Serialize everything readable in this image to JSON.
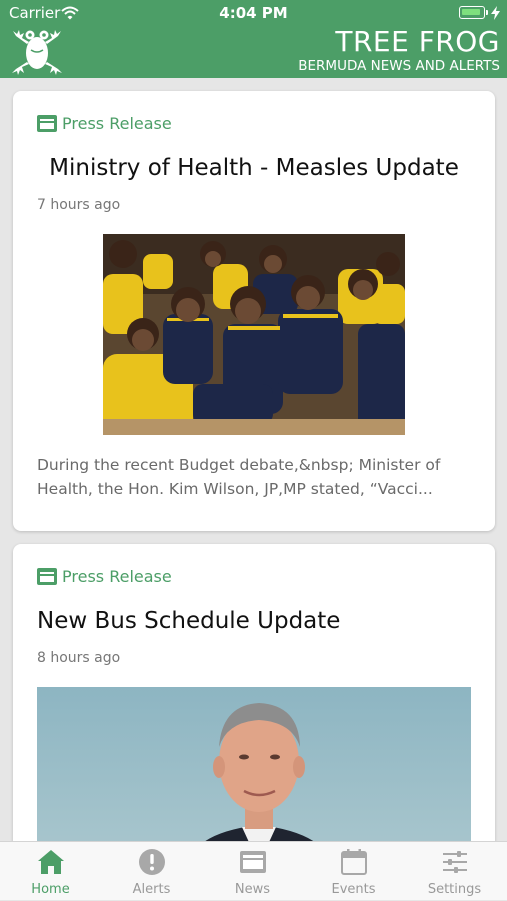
{
  "status_bar": {
    "carrier": "Carrier",
    "time": "4:04 PM"
  },
  "header": {
    "title": "TREE FROG",
    "subtitle": "BERMUDA NEWS AND ALERTS"
  },
  "colors": {
    "brand": "#4c9e67",
    "tab_inactive": "#999999"
  },
  "articles": [
    {
      "category": "Press Release",
      "title": "Ministry of Health - Measles Update",
      "time_ago": "7 hours ago",
      "excerpt": "During the recent Budget debate,&nbsp; Minister of Health, the Hon. Kim Wilson, JP,MP stated, “Vacci..."
    },
    {
      "category": "Press Release",
      "title": "New Bus Schedule Update",
      "time_ago": "8 hours ago"
    }
  ],
  "tabs": [
    {
      "label": "Home",
      "icon": "home-icon",
      "active": true
    },
    {
      "label": "Alerts",
      "icon": "alert-icon",
      "active": false
    },
    {
      "label": "News",
      "icon": "news-icon",
      "active": false
    },
    {
      "label": "Events",
      "icon": "calendar-icon",
      "active": false
    },
    {
      "label": "Settings",
      "icon": "settings-icon",
      "active": false
    }
  ]
}
